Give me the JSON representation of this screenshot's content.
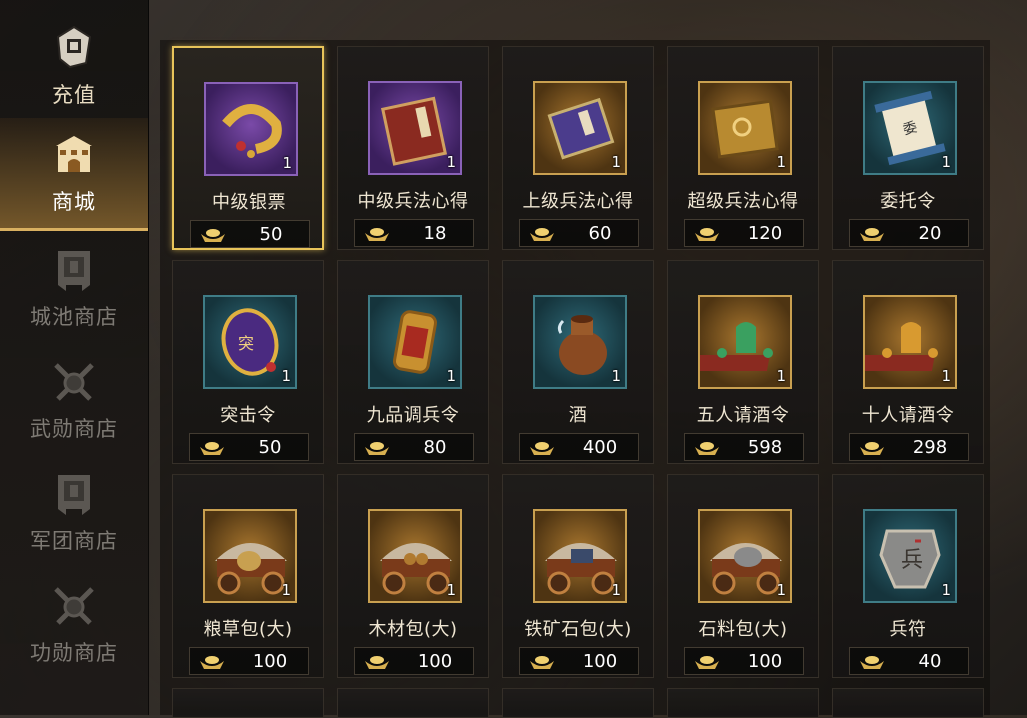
{
  "sidebar": {
    "items": [
      {
        "label": "充值",
        "icon": "recharge-scroll-icon"
      },
      {
        "label": "商城",
        "icon": "city-gate-icon"
      },
      {
        "label": "城池商店",
        "icon": "banner-icon"
      },
      {
        "label": "武勋商店",
        "icon": "crossed-swords-icon"
      },
      {
        "label": "军团商店",
        "icon": "banner-icon"
      },
      {
        "label": "功勋商店",
        "icon": "crossed-swords-icon"
      }
    ]
  },
  "shop": {
    "items": [
      {
        "name": "中级银票",
        "qty": "1",
        "price": "50",
        "icon": "coin-string-icon",
        "frame": "purple"
      },
      {
        "name": "中级兵法心得",
        "qty": "1",
        "price": "18",
        "icon": "red-book-icon",
        "frame": "purple"
      },
      {
        "name": "上级兵法心得",
        "qty": "1",
        "price": "60",
        "icon": "blue-book-icon",
        "frame": "gold"
      },
      {
        "name": "超级兵法心得",
        "qty": "1",
        "price": "120",
        "icon": "gold-book-icon",
        "frame": "gold"
      },
      {
        "name": "委托令",
        "qty": "1",
        "price": "20",
        "icon": "scroll-icon",
        "frame": "teal"
      },
      {
        "name": "突击令",
        "qty": "1",
        "price": "50",
        "icon": "assault-token-icon",
        "frame": "teal"
      },
      {
        "name": "九品调兵令",
        "qty": "1",
        "price": "80",
        "icon": "troop-token-icon",
        "frame": "teal"
      },
      {
        "name": "酒",
        "qty": "1",
        "price": "400",
        "icon": "wine-jar-icon",
        "frame": "teal"
      },
      {
        "name": "五人请酒令",
        "qty": "1",
        "price": "598",
        "icon": "wine-set-green-icon",
        "frame": "gold"
      },
      {
        "name": "十人请酒令",
        "qty": "1",
        "price": "298",
        "icon": "wine-set-gold-icon",
        "frame": "gold"
      },
      {
        "name": "粮草包(大)",
        "qty": "1",
        "price": "100",
        "icon": "grain-cart-icon",
        "frame": "gold"
      },
      {
        "name": "木材包(大)",
        "qty": "1",
        "price": "100",
        "icon": "wood-cart-icon",
        "frame": "gold"
      },
      {
        "name": "铁矿石包(大)",
        "qty": "1",
        "price": "100",
        "icon": "iron-cart-icon",
        "frame": "gold"
      },
      {
        "name": "石料包(大)",
        "qty": "1",
        "price": "100",
        "icon": "stone-cart-icon",
        "frame": "gold"
      },
      {
        "name": "兵符",
        "qty": "1",
        "price": "40",
        "icon": "army-tally-icon",
        "frame": "teal"
      }
    ],
    "currency_icon": "gold-ingot-icon"
  }
}
